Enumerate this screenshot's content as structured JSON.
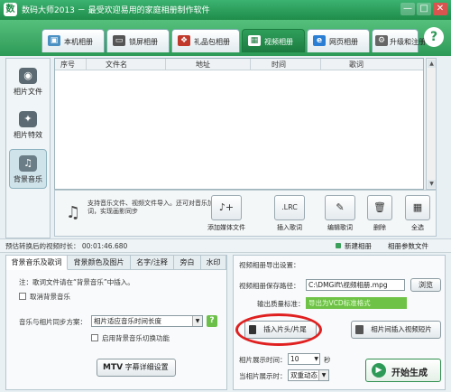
{
  "app": {
    "logo_glyph": "数",
    "title": "数码大师2013 － 最受欢迎易用的家庭相册制作软件",
    "window_buttons": [
      "—",
      "□",
      "✕"
    ]
  },
  "tabs": [
    {
      "label": "本机相册",
      "icon": "monitor-icon",
      "glyph": "▣",
      "active": false
    },
    {
      "label": "锁屏相册",
      "icon": "screen-icon",
      "glyph": "▭",
      "active": false
    },
    {
      "label": "礼品包相册",
      "icon": "gift-icon",
      "glyph": "❖",
      "active": false
    },
    {
      "label": "视频相册",
      "icon": "film-icon",
      "glyph": "▦",
      "active": true
    },
    {
      "label": "网页相册",
      "icon": "ie-icon",
      "glyph": "e",
      "active": false
    },
    {
      "label": "升级和注册",
      "icon": "gear-icon",
      "glyph": "⚙",
      "active": false
    }
  ],
  "help_glyph": "?",
  "sidebar": {
    "items": [
      {
        "label": "相片文件",
        "icon": "camera-icon",
        "glyph": "◉",
        "active": false
      },
      {
        "label": "相片特效",
        "icon": "sparkle-icon",
        "glyph": "✦",
        "active": false
      },
      {
        "label": "背景音乐",
        "icon": "music-note-icon",
        "glyph": "♫",
        "active": true
      }
    ]
  },
  "file_table": {
    "columns": [
      "序号",
      "文件名",
      "地址",
      "时间",
      "歌词"
    ],
    "rows": []
  },
  "toolbar": {
    "help_text": "支持音乐文件、视频文件导入。还可对音乐加歌词，实现画影同步",
    "buttons": [
      {
        "label": "添加媒体文件",
        "glyph": "♪+",
        "icon": "add-media-icon"
      },
      {
        "label": "插入歌词",
        "glyph": ".LRC",
        "icon": "lrc-icon"
      },
      {
        "label": "编辑歌词",
        "glyph": "✎",
        "icon": "edit-lyrics-icon"
      },
      {
        "label": "删除",
        "glyph": "🗑",
        "icon": "trash-icon"
      },
      {
        "label": "全选",
        "glyph": "▦",
        "icon": "select-all-icon"
      }
    ]
  },
  "status": {
    "duration_label": "预估转换后的视频时长：",
    "duration_value": "00:01:46.680",
    "new_album": "新建相册",
    "album_params": "相册参数文件"
  },
  "bottom_tabs": [
    "背景音乐及歌词",
    "背景颜色及图片",
    "名字/注释",
    "旁白",
    "水印"
  ],
  "music_panel": {
    "note": "注：歌词文件请在“背景音乐”中插入。",
    "cancel_music_label": "取消背景音乐",
    "cancel_music_checked": false,
    "sync_label": "音乐与相片同步方案：",
    "sync_value": "相片适应音乐时间长度",
    "fade_label": "启用背景音乐切换功能",
    "fade_checked": false,
    "mtv_button": {
      "prefix": "MTV",
      "label": "字幕详细设置"
    }
  },
  "export_panel": {
    "heading": "视频相册导出设置：",
    "path_label": "视频相册保存路径：",
    "path_value": "C:\\DMGift\\视频相册.mpg",
    "browse_button": "浏览",
    "format_label": "输出质量标准：",
    "format_value": "导出为VCD标准格式",
    "insert_head_button": "插入片头/片尾",
    "insert_clip_button": "相片间插入视频短片",
    "photo_time_label": "相片展示时间：",
    "photo_time_value": "10",
    "photo_time_unit": "秒",
    "transition_label": "当相片展示时：",
    "transition_value": "双重动态",
    "start_button": "开始生成",
    "start_glyph": "▶"
  }
}
